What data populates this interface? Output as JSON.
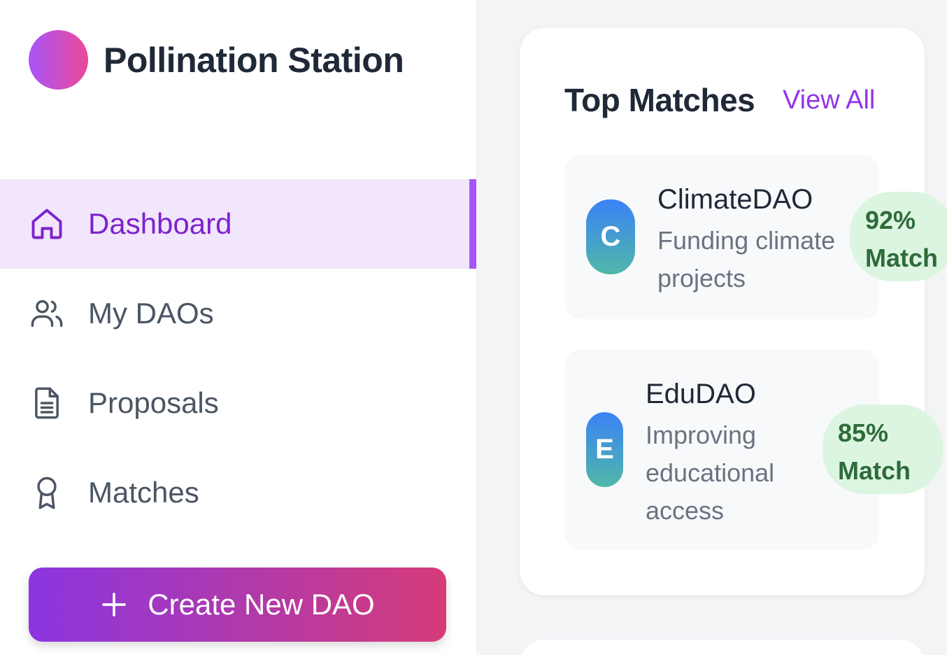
{
  "brand": {
    "name": "Pollination Station"
  },
  "nav": {
    "items": [
      {
        "label": "Dashboard",
        "icon": "home-icon",
        "active": true
      },
      {
        "label": "My DAOs",
        "icon": "users-icon",
        "active": false
      },
      {
        "label": "Proposals",
        "icon": "document-icon",
        "active": false
      },
      {
        "label": "Matches",
        "icon": "award-icon",
        "active": false
      }
    ]
  },
  "create_button": {
    "label": "Create New DAO",
    "icon": "plus-icon"
  },
  "top_matches": {
    "title": "Top Matches",
    "view_all": "View All",
    "items": [
      {
        "initial": "C",
        "name": "ClimateDAO",
        "description": "Funding climate projects",
        "match": "92% Match"
      },
      {
        "initial": "E",
        "name": "EduDAO",
        "description": "Improving educational access",
        "match": "85% Match"
      }
    ]
  },
  "colors": {
    "accent": "#a855f7",
    "accent_text": "#7e22ce",
    "active_bg": "#f1e6fb",
    "badge_bg": "#dcf5e1",
    "badge_text": "#2e6b3a"
  }
}
